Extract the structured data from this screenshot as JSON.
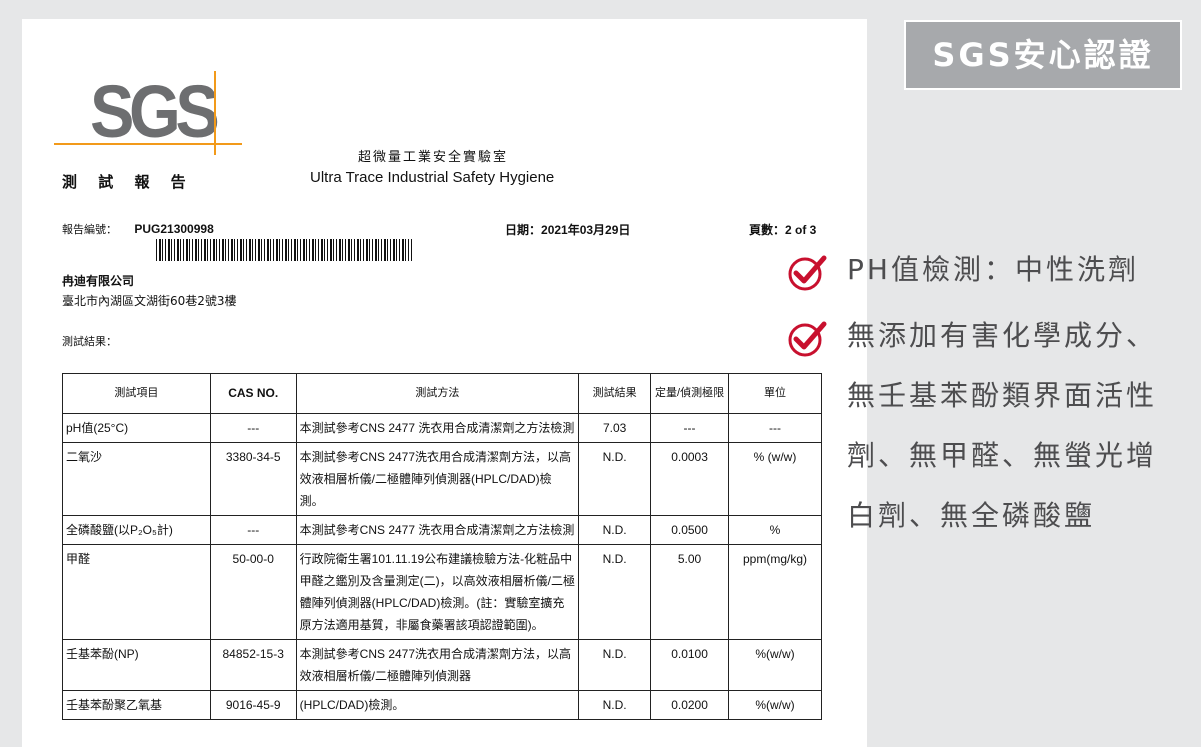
{
  "badge": {
    "label": "SGS安心認證"
  },
  "report": {
    "logo": "SGS",
    "title": "測 試 報 告",
    "lab_name_cn": "超微量工業安全實驗室",
    "lab_name_en": "Ultra Trace Industrial Safety Hygiene",
    "report_no_label": "報告編號：",
    "report_no": "PUG21300998",
    "date_label": "日期：",
    "date": "2021年03月29日",
    "page_label": "頁數：",
    "page": "2 of 3",
    "company": "冉迪有限公司",
    "address": "臺北市內湖區文湖街60巷2號3樓",
    "result_label": "測試結果："
  },
  "table": {
    "headers": {
      "item": "測試項目",
      "cas": "CAS NO.",
      "method": "測試方法",
      "result": "測試結果",
      "limit": "定量/偵測極限",
      "unit": "單位"
    },
    "rows": [
      {
        "item": "pH值(25°C)",
        "cas": "---",
        "method": "本測試參考CNS 2477 洗衣用合成清潔劑之方法檢測",
        "result": "7.03",
        "limit": "---",
        "unit": "---"
      },
      {
        "item": "二氧沙",
        "cas": "3380-34-5",
        "method": "本測試參考CNS 2477洗衣用合成清潔劑方法，以高效液相層析儀/二極體陣列偵測器(HPLC/DAD)檢測。",
        "result": "N.D.",
        "limit": "0.0003",
        "unit": "% (w/w)"
      },
      {
        "item": "全磷酸鹽(以P₂O₅計)",
        "cas": "---",
        "method": "本測試參考CNS 2477 洗衣用合成清潔劑之方法檢測",
        "result": "N.D.",
        "limit": "0.0500",
        "unit": "%"
      },
      {
        "item": "甲醛",
        "cas": "50-00-0",
        "method": "行政院衛生署101.11.19公布建議檢驗方法-化粧品中甲醛之鑑別及含量測定(二)，以高效液相層析儀/二極體陣列偵測器(HPLC/DAD)檢測。(註：實驗室擴充原方法適用基質，非屬食藥署該項認證範圍)。",
        "result": "N.D.",
        "limit": "5.00",
        "unit": "ppm(mg/kg)"
      },
      {
        "item": "壬基苯酚(NP)",
        "cas": "84852-15-3",
        "method": "本測試參考CNS 2477洗衣用合成清潔劑方法，以高效液相層析儀/二極體陣列偵測器",
        "result": "N.D.",
        "limit": "0.0100",
        "unit": "%(w/w)"
      },
      {
        "item": "壬基苯酚聚乙氧基",
        "cas": "9016-45-9",
        "method": "(HPLC/DAD)檢測。",
        "result": "N.D.",
        "limit": "0.0200",
        "unit": "%(w/w)"
      }
    ]
  },
  "features": [
    {
      "text": "PH值檢測：中性洗劑"
    },
    {
      "lines": [
        "無添加有害化學成分、",
        "無壬基苯酚類界面活性",
        "劑、無甲醛、無螢光增",
        "白劑、無全磷酸鹽"
      ]
    }
  ],
  "colors": {
    "background": "#e6e7e8",
    "badge": "#a7a9ac",
    "check": "#c8102e",
    "logo_accent": "#f29a1a"
  },
  "icons": {
    "feature_bullet": "check-circle-icon"
  }
}
